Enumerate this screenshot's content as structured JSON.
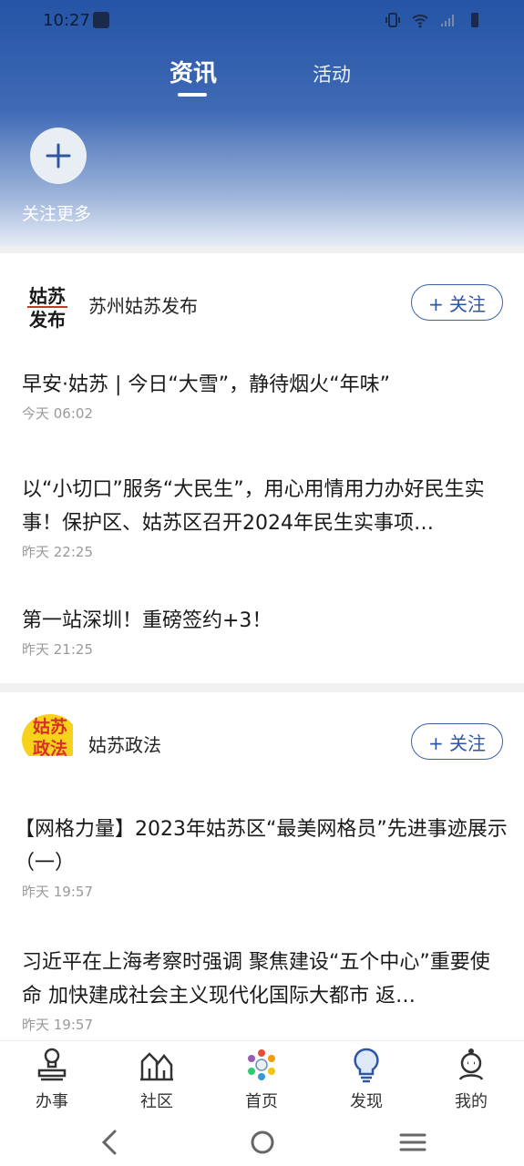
{
  "status_bar": {
    "time": "10:27"
  },
  "tabs": [
    {
      "label": "资讯",
      "active": true
    },
    {
      "label": "活动",
      "active": false
    }
  ],
  "follow_more": {
    "label": "关注更多"
  },
  "accent_color": "#2f56a3",
  "cards": [
    {
      "source": "苏州姑苏发布",
      "logo_text": [
        "姑苏",
        "发布"
      ],
      "follow_label": "+ 关注",
      "articles": [
        {
          "title": "早安·姑苏 | 今日“大雪”，静待烟火“年味”",
          "time": "今天  06:02"
        },
        {
          "title": "以“小切口”服务“大民生”，用心用情用力办好民生实事！保护区、姑苏区召开2024年民生实事项…",
          "time": "昨天 22:25"
        },
        {
          "title": "第一站深圳！重磅签约+3！",
          "time": "昨天 21:25"
        }
      ]
    },
    {
      "source": "姑苏政法",
      "logo_text": [
        "姑苏",
        "政法"
      ],
      "follow_label": "+ 关注",
      "articles": [
        {
          "title": "【网格力量】2023年姑苏区“最美网格员”先进事迹展示（一）",
          "time": "昨天 19:57"
        },
        {
          "title": "习近平在上海考察时强调 聚焦建设“五个中心”重要使命 加快建成社会主义现代化国际大都市 返…",
          "time": "昨天 19:57"
        }
      ]
    }
  ],
  "bottom_nav": [
    {
      "label": "办事",
      "icon": "stamp-icon"
    },
    {
      "label": "社区",
      "icon": "community-icon"
    },
    {
      "label": "首页",
      "icon": "home-logo-icon"
    },
    {
      "label": "发现",
      "icon": "lightbulb-icon"
    },
    {
      "label": "我的",
      "icon": "profile-icon"
    }
  ]
}
